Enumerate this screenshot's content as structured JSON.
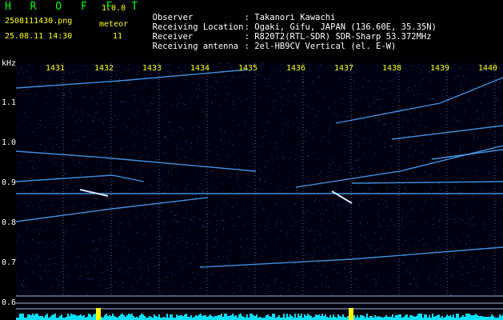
{
  "header": {
    "brand": "H R O F F T",
    "version": "1.0.0",
    "filename": "2508111430.png",
    "datetime": "25.08.11 14:30",
    "meteor_label": "meteor",
    "meteor_count": "11"
  },
  "meta": [
    {
      "key": "Observer",
      "value": ": Takanori Kawachi"
    },
    {
      "key": "Receiving Location",
      "value": ": Ogaki, Gifu, JAPAN (136.60E, 35.35N)"
    },
    {
      "key": "Receiver",
      "value": ": R820T2(RTL-SDR) SDR-Sharp 53.372MHz"
    },
    {
      "key": "Receiving antenna",
      "value": ": 2el-HB9CV Vertical (el. E-W)"
    }
  ],
  "axis": {
    "y_unit": "kHz",
    "x_ticks": [
      "1431",
      "1432",
      "1433",
      "1434",
      "1435",
      "1436",
      "1437",
      "1438",
      "1439",
      "1440"
    ],
    "y_ticks": [
      "1.1",
      "1.0",
      "0.9",
      "0.8",
      "0.7",
      "0.6"
    ]
  },
  "colors": {
    "brand": "#00ff00",
    "labels": "#ffff00",
    "background": "#000010",
    "signal": "#4aa8ff",
    "baseline": "#00e0ff"
  }
}
